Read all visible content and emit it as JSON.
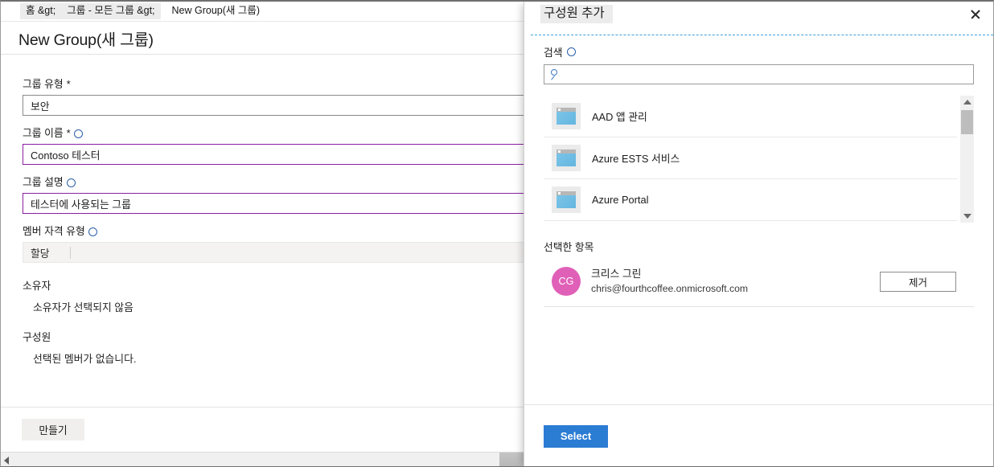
{
  "blade": {
    "breadcrumb": [
      {
        "label": "홈 &gt;",
        "highlighted": true
      },
      {
        "label": "그룹 - 모든 그룹 &gt;",
        "highlighted": true
      },
      {
        "label": "New Group(새 그룹)",
        "highlighted": false
      }
    ],
    "title": "New Group(새 그룹)",
    "fields": {
      "group_type": {
        "label": "그룹 유형",
        "required": "*",
        "value": "보안"
      },
      "group_name": {
        "label": "그룹 이름",
        "required": "*",
        "value": "Contoso 테스터"
      },
      "group_description": {
        "label": "그룹 설명",
        "value": "테스터에 사용되는 그룹"
      },
      "membership_type": {
        "label": "멤버 자격 유형",
        "value": "할당"
      }
    },
    "owners": {
      "heading": "소유자",
      "status": "소유자가 선택되지 않음"
    },
    "members": {
      "heading": "구성원",
      "status": "선택된 멤버가 없습니다."
    },
    "create_button": "만들기"
  },
  "panel": {
    "title": "구성원 추가",
    "close_label": "닫기",
    "search": {
      "label": "검색",
      "value": "",
      "placeholder": ""
    },
    "results": [
      {
        "name": "AAD 앱 관리"
      },
      {
        "name": "Azure ESTS 서비스"
      },
      {
        "name": "Azure Portal"
      }
    ],
    "selected": {
      "heading": "선택한 항목",
      "items": [
        {
          "initials": "CG",
          "name": "크리스 그린",
          "email": "chris@fourthcoffee.onmicrosoft.com",
          "remove_label": "제거",
          "avatar_color": "#e060b8"
        }
      ]
    },
    "select_button": "Select"
  },
  "colors": {
    "accent_blue": "#2b7cd3",
    "input_focus_purple": "#8a1fa0",
    "valid_green": "#6cb33f",
    "dashed_divider": "#3aa0dd"
  }
}
